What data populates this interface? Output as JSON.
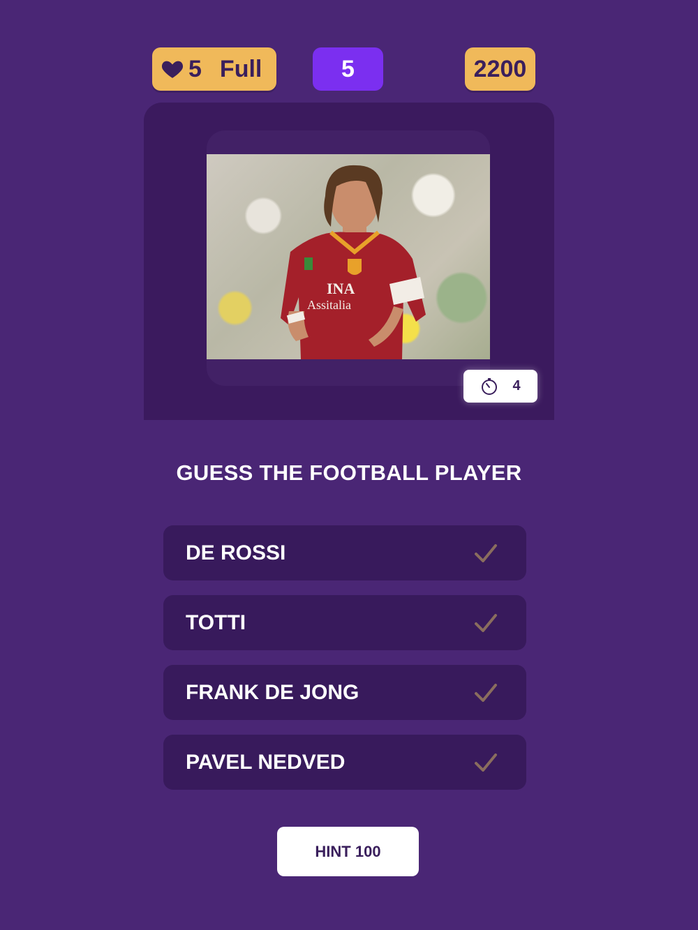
{
  "header": {
    "lives": "5",
    "lives_status": "Full",
    "level": "5",
    "score": "2200",
    "heart_icon": "heart-icon",
    "accent_gold": "#f0b95a",
    "accent_purple": "#7b2ff0"
  },
  "timer": {
    "value": "4",
    "icon": "stopwatch-icon"
  },
  "question": {
    "text": "GUESS THE FOOTBALL PLAYER"
  },
  "answers": [
    {
      "label": "DE ROSSI"
    },
    {
      "label": "TOTTI"
    },
    {
      "label": "FRANK DE JONG"
    },
    {
      "label": "PAVEL NEDVED"
    }
  ],
  "hint": {
    "label": "HINT 100"
  },
  "photo": {
    "jersey_sponsor_line1": "INA",
    "jersey_sponsor_line2": "Assitalia"
  }
}
